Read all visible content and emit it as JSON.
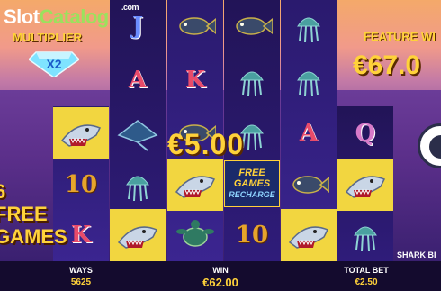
{
  "logo": {
    "slot": "Slot",
    "catalog": "Catalog",
    "com": ".com"
  },
  "multiplier": {
    "label": "MULTIPLIER",
    "value": "X2"
  },
  "free_spins_badge": {
    "line1": "6",
    "line2": "FREE",
    "line3": "GAMES"
  },
  "feature_win": {
    "label": "FEATURE WI",
    "value": "€67.0"
  },
  "win_amount": "€5.00",
  "free_games_badge": {
    "line1": "FREE",
    "line2": "GAMES",
    "line3": "RECHARGE"
  },
  "shark_bite_label": "SHARK BI",
  "reels": [
    [
      "",
      "",
      "shark",
      "10",
      "K"
    ],
    [
      "J",
      "A",
      "ray",
      "jellyfish",
      "shark"
    ],
    [
      "fish",
      "K",
      "fish",
      "shark",
      "turtle"
    ],
    [
      "fish",
      "jellyfish",
      "jellyfish",
      "free-games",
      "10"
    ],
    [
      "jellyfish",
      "jellyfish",
      "A",
      "fish",
      "shark"
    ],
    [
      "",
      "",
      "Q",
      "shark",
      "jellyfish"
    ]
  ],
  "footer": {
    "ways_label": "WAYS",
    "ways_value": "5625",
    "win_label": "WIN",
    "win_value": "€62.00",
    "bet_label": "TOTAL BET",
    "bet_value": "€2.50"
  },
  "colors": {
    "gold": "#ffd23a",
    "reel": "#2f1c7a",
    "shark_bg": "#f2d640",
    "footer": "#140b2e"
  }
}
